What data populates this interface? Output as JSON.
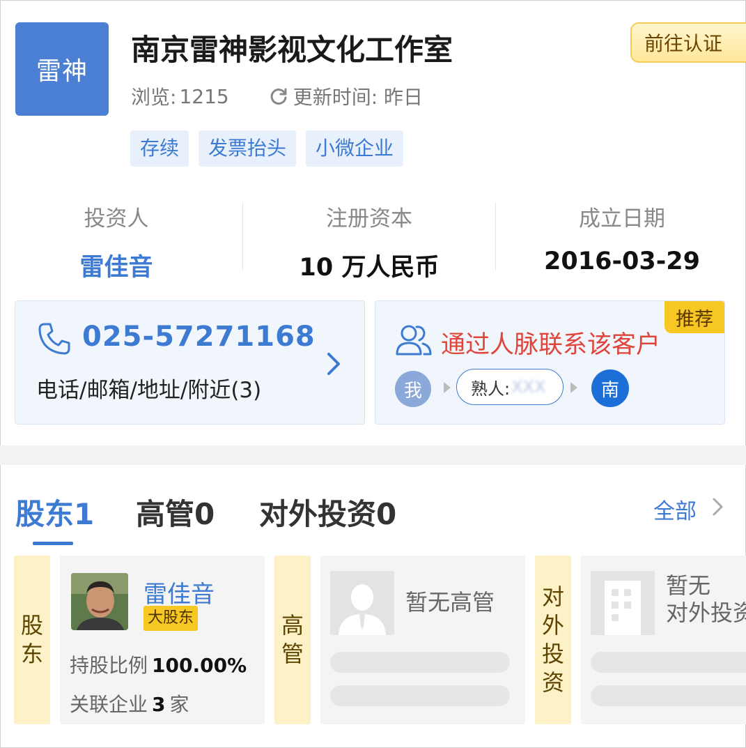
{
  "company": {
    "logo_text": "雷神",
    "name": "南京雷神影视文化工作室",
    "verify_button": "前往认证",
    "views_label": "浏览:",
    "views_value": "1215",
    "update_label": "更新时间: 昨日",
    "tags": [
      "存续",
      "发票抬头",
      "小微企业"
    ]
  },
  "stats": [
    {
      "label": "投资人",
      "value": "雷佳音"
    },
    {
      "label": "注册资本",
      "value": "10 万人民币"
    },
    {
      "label": "成立日期",
      "value": "2016-03-29"
    }
  ],
  "contact_card": {
    "phone": "025-57271168",
    "subtitle": "电话/邮箱/地址/附近(3)"
  },
  "network_card": {
    "title": "通过人脉联系该客户",
    "badge": "推荐",
    "me_label": "我",
    "acquaintance_label": "熟人:",
    "acquaintance_value": "XXX",
    "target_label": "南"
  },
  "tabs": {
    "shareholders": "股东1",
    "executives": "高管0",
    "investments": "对外投资0",
    "view_all": "全部"
  },
  "shareholder_section": {
    "side_label": [
      "股",
      "东"
    ],
    "name": "雷佳音",
    "badge": "大股东",
    "ratio_label": "持股比例",
    "ratio_value": "100.00%",
    "related_label": "关联企业",
    "related_value": "3",
    "related_unit": "家"
  },
  "executive_section": {
    "side_label": [
      "高",
      "管"
    ],
    "empty_text": "暂无高管"
  },
  "investment_section": {
    "side_label": [
      "对",
      "外",
      "投",
      "资"
    ],
    "empty_line1": "暂无",
    "empty_line2": "对外投资"
  },
  "colors": {
    "primary_blue": "#3d7ad1",
    "logo_blue": "#4a7fd3",
    "accent_red": "#e0453b",
    "badge_yellow": "#f7c724",
    "label_yellow": "#fdf1c7"
  }
}
